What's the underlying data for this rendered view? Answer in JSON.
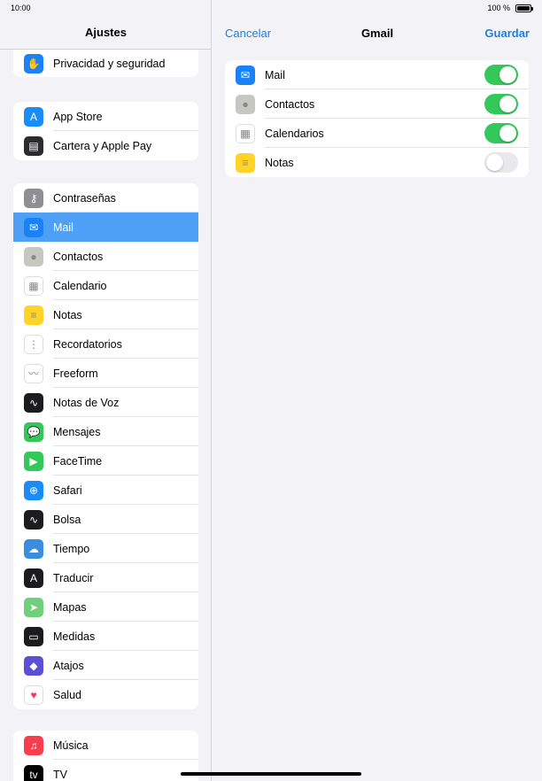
{
  "status_bar": {
    "time": "10:00",
    "battery": "100 %"
  },
  "sidebar": {
    "title": "Ajustes",
    "groups": [
      [
        {
          "label": "Privacidad y seguridad",
          "icon": "hand-icon",
          "color": "#1a82f7",
          "glyph": "✋"
        }
      ],
      [
        {
          "label": "App Store",
          "icon": "app-store-icon",
          "color": "#1a8cf7",
          "glyph": "A"
        },
        {
          "label": "Cartera y Apple Pay",
          "icon": "wallet-icon",
          "color": "#2c2c2e",
          "glyph": "▤"
        }
      ],
      [
        {
          "label": "Contraseñas",
          "icon": "key-icon",
          "color": "#8e8e93",
          "glyph": "⚷"
        },
        {
          "label": "Mail",
          "icon": "mail-icon",
          "color": "#1a82f7",
          "glyph": "✉",
          "selected": true
        },
        {
          "label": "Contactos",
          "icon": "contacts-icon",
          "color": "#c7c7c2",
          "glyph": "●"
        },
        {
          "label": "Calendario",
          "icon": "calendar-icon",
          "color": "#ffffff",
          "glyph": "▦"
        },
        {
          "label": "Notas",
          "icon": "notes-icon",
          "color": "#ffd426",
          "glyph": "≡"
        },
        {
          "label": "Recordatorios",
          "icon": "reminders-icon",
          "color": "#ffffff",
          "glyph": "⋮"
        },
        {
          "label": "Freeform",
          "icon": "freeform-icon",
          "color": "#ffffff",
          "glyph": "〰"
        },
        {
          "label": "Notas de Voz",
          "icon": "voice-memos-icon",
          "color": "#1c1c1e",
          "glyph": "∿"
        },
        {
          "label": "Mensajes",
          "icon": "messages-icon",
          "color": "#34c759",
          "glyph": "💬"
        },
        {
          "label": "FaceTime",
          "icon": "facetime-icon",
          "color": "#34c759",
          "glyph": "▶"
        },
        {
          "label": "Safari",
          "icon": "safari-icon",
          "color": "#1a8cf7",
          "glyph": "⊕"
        },
        {
          "label": "Bolsa",
          "icon": "stocks-icon",
          "color": "#1c1c1e",
          "glyph": "∿"
        },
        {
          "label": "Tiempo",
          "icon": "weather-icon",
          "color": "#3b8de0",
          "glyph": "☁"
        },
        {
          "label": "Traducir",
          "icon": "translate-icon",
          "color": "#1c1c1e",
          "glyph": "A"
        },
        {
          "label": "Mapas",
          "icon": "maps-icon",
          "color": "#6fcf7b",
          "glyph": "➤"
        },
        {
          "label": "Medidas",
          "icon": "measure-icon",
          "color": "#1c1c1e",
          "glyph": "▭"
        },
        {
          "label": "Atajos",
          "icon": "shortcuts-icon",
          "color": "#5a4fd6",
          "glyph": "◆"
        },
        {
          "label": "Salud",
          "icon": "health-icon",
          "color": "#ffffff",
          "glyph": "♥"
        }
      ],
      [
        {
          "label": "Música",
          "icon": "music-icon",
          "color": "#fa3c4f",
          "glyph": "♫"
        },
        {
          "label": "TV",
          "icon": "tv-icon",
          "color": "#000000",
          "glyph": "tv"
        }
      ]
    ]
  },
  "detail": {
    "cancel": "Cancelar",
    "title": "Gmail",
    "save": "Guardar",
    "items": [
      {
        "label": "Mail",
        "icon": "mail-icon",
        "color": "#1a82f7",
        "glyph": "✉",
        "enabled": true
      },
      {
        "label": "Contactos",
        "icon": "contacts-icon",
        "color": "#c7c7c2",
        "glyph": "●",
        "enabled": true
      },
      {
        "label": "Calendarios",
        "icon": "calendar-icon",
        "color": "#ffffff",
        "glyph": "▦",
        "enabled": true
      },
      {
        "label": "Notas",
        "icon": "notes-icon",
        "color": "#ffd426",
        "glyph": "≡",
        "enabled": false
      }
    ]
  }
}
